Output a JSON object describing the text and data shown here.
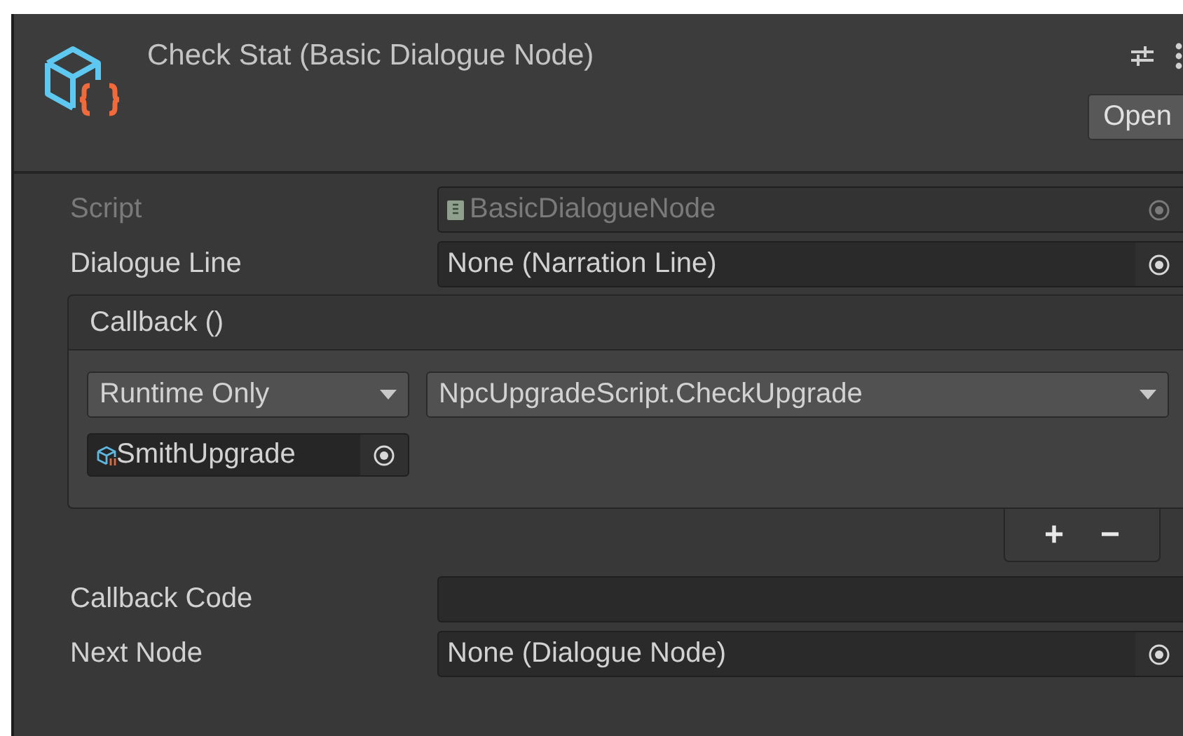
{
  "header": {
    "title": "Check Stat (Basic Dialogue Node)",
    "open_button": "Open"
  },
  "fields": [
    {
      "kind": "script",
      "label": "Script",
      "value": "BasicDialogueNode",
      "disabled": true
    },
    {
      "kind": "object",
      "label": "Dialogue Line",
      "value": "None (Narration Line)",
      "disabled": false
    }
  ],
  "callback": {
    "title": "Callback ()",
    "mode": "Runtime Only",
    "function": "NpcUpgradeScript.CheckUpgrade",
    "target": "SmithUpgrade",
    "add": "+",
    "remove": "−"
  },
  "after_fields": [
    {
      "kind": "text",
      "label": "Callback Code"
    },
    {
      "kind": "object",
      "label": "Next Node",
      "value": "None (Dialogue Node)",
      "disabled": false
    }
  ]
}
